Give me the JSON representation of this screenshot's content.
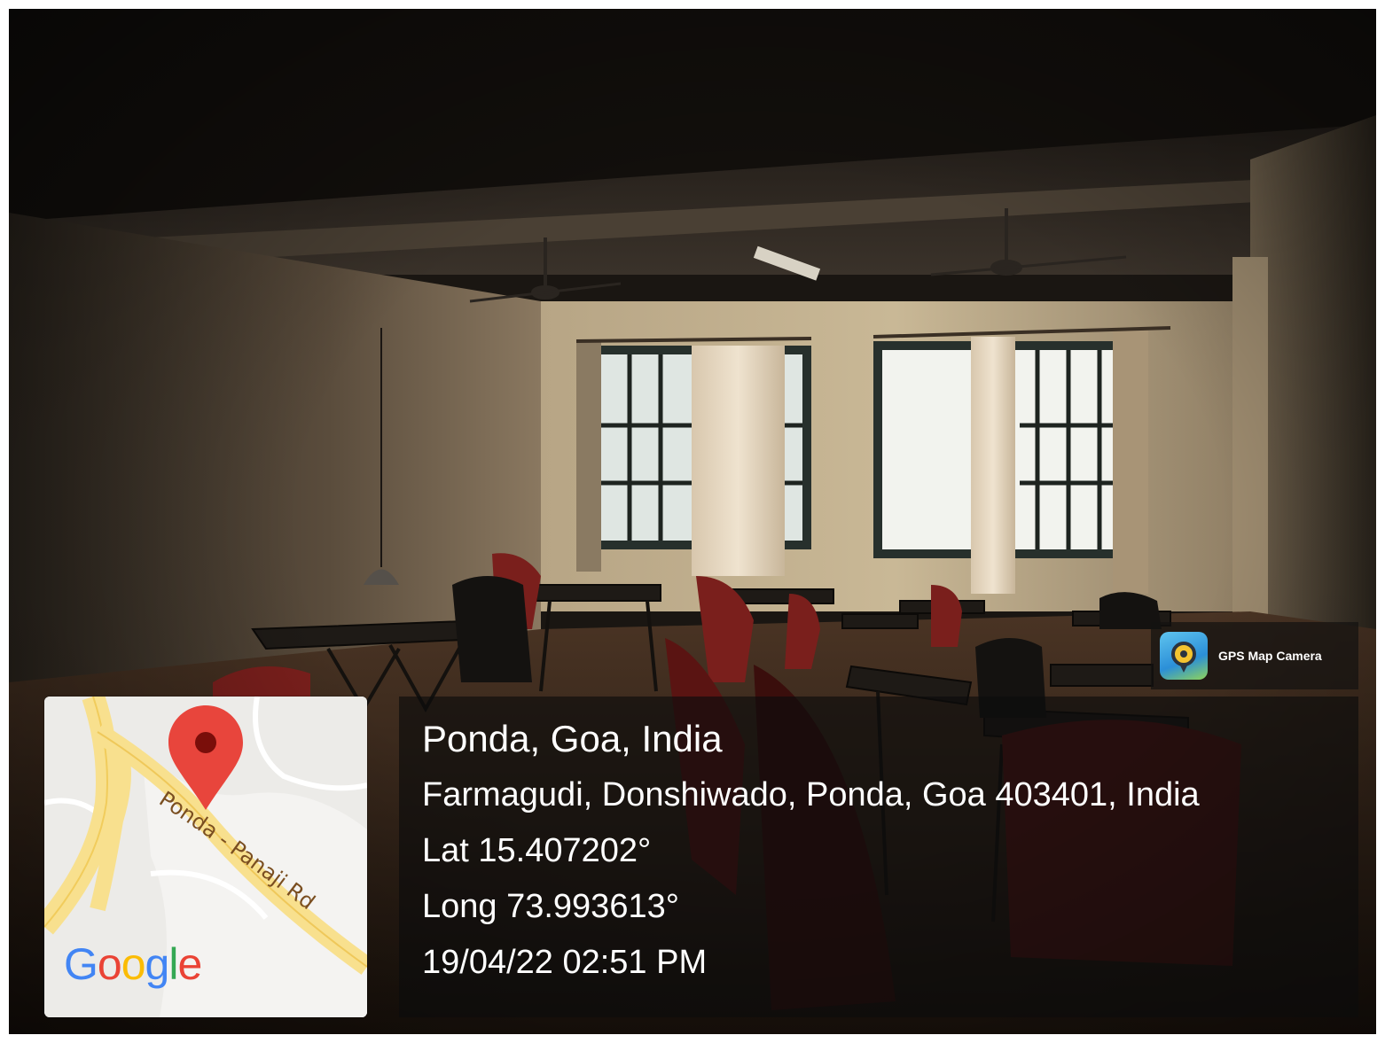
{
  "app_badge": {
    "name": "GPS Map Camera",
    "icon": "gps-map-camera-icon"
  },
  "location": {
    "title": "Ponda, Goa, India",
    "address": "Farmagudi, Donshiwado, Ponda, Goa 403401, India",
    "latitude": "Lat 15.407202°",
    "longitude": "Long 73.993613°",
    "datetime": "19/04/22 02:51 PM"
  },
  "map": {
    "road_label": "Ponda - Panaji Rd",
    "logo_text": "Google",
    "logo_letters": [
      {
        "ch": "G",
        "color": "#4285F4"
      },
      {
        "ch": "o",
        "color": "#EA4335"
      },
      {
        "ch": "o",
        "color": "#FBBC05"
      },
      {
        "ch": "g",
        "color": "#4285F4"
      },
      {
        "ch": "l",
        "color": "#34A853"
      },
      {
        "ch": "e",
        "color": "#EA4335"
      }
    ],
    "marker_color": "#E8453C"
  }
}
